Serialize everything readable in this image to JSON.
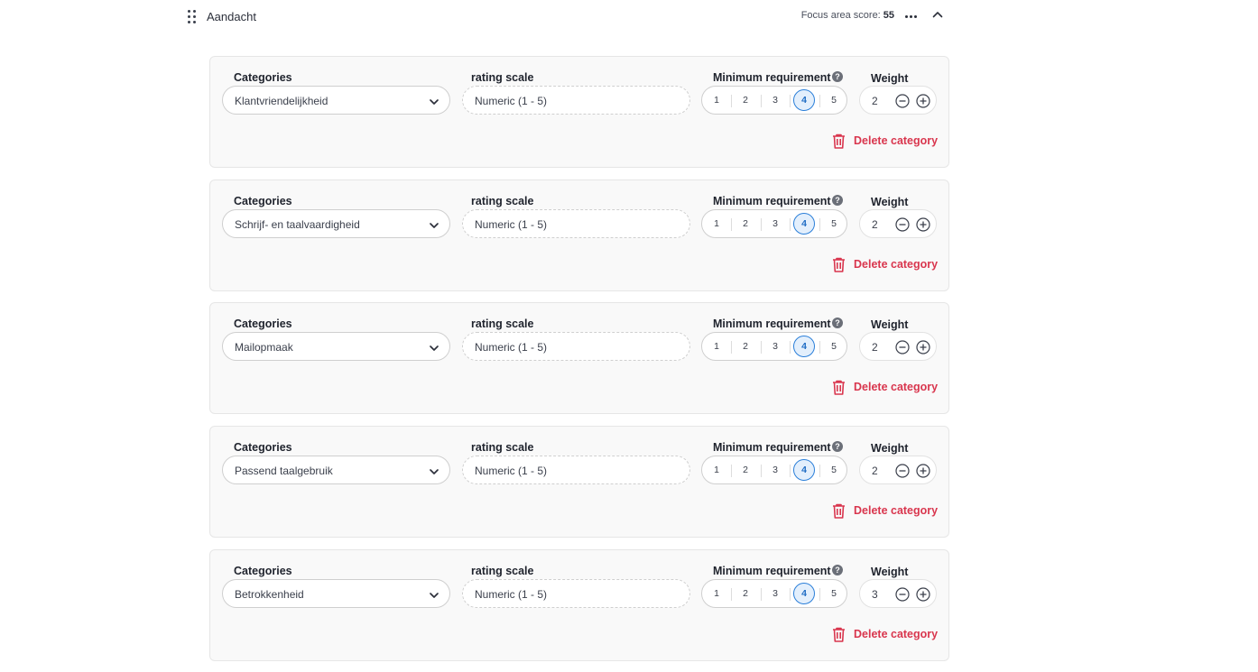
{
  "section": {
    "title": "Aandacht",
    "score_label": "Focus area score:",
    "score_value": "55"
  },
  "labels": {
    "categories": "Categories",
    "rating_scale": "rating scale",
    "minimum_requirement": "Minimum requirement",
    "info": "?",
    "weight": "Weight",
    "delete": "Delete category"
  },
  "scale_options": [
    "1",
    "2",
    "3",
    "4",
    "5"
  ],
  "colors": {
    "accent": "#2b7fd9",
    "danger": "#d9364e",
    "card_bg": "#f9f9f9"
  },
  "icons": {
    "drag": "drag-handle-icon",
    "more": "more-horizontal-icon",
    "collapse": "chevron-up-icon",
    "select": "chevron-down-icon",
    "minus": "minus-circle-icon",
    "plus": "plus-circle-icon",
    "delete": "trash-icon",
    "info": "info-icon"
  },
  "cards": [
    {
      "category": "Klantvriendelijkheid",
      "scale": "Numeric (1 - 5)",
      "min_requirement": 4,
      "weight": "2"
    },
    {
      "category": "Schrijf- en taalvaardigheid",
      "scale": "Numeric (1 - 5)",
      "min_requirement": 4,
      "weight": "2"
    },
    {
      "category": "Mailopmaak",
      "scale": "Numeric (1 - 5)",
      "min_requirement": 4,
      "weight": "2"
    },
    {
      "category": "Passend taalgebruik",
      "scale": "Numeric (1 - 5)",
      "min_requirement": 4,
      "weight": "2"
    },
    {
      "category": "Betrokkenheid",
      "scale": "Numeric (1 - 5)",
      "min_requirement": 4,
      "weight": "3"
    }
  ]
}
